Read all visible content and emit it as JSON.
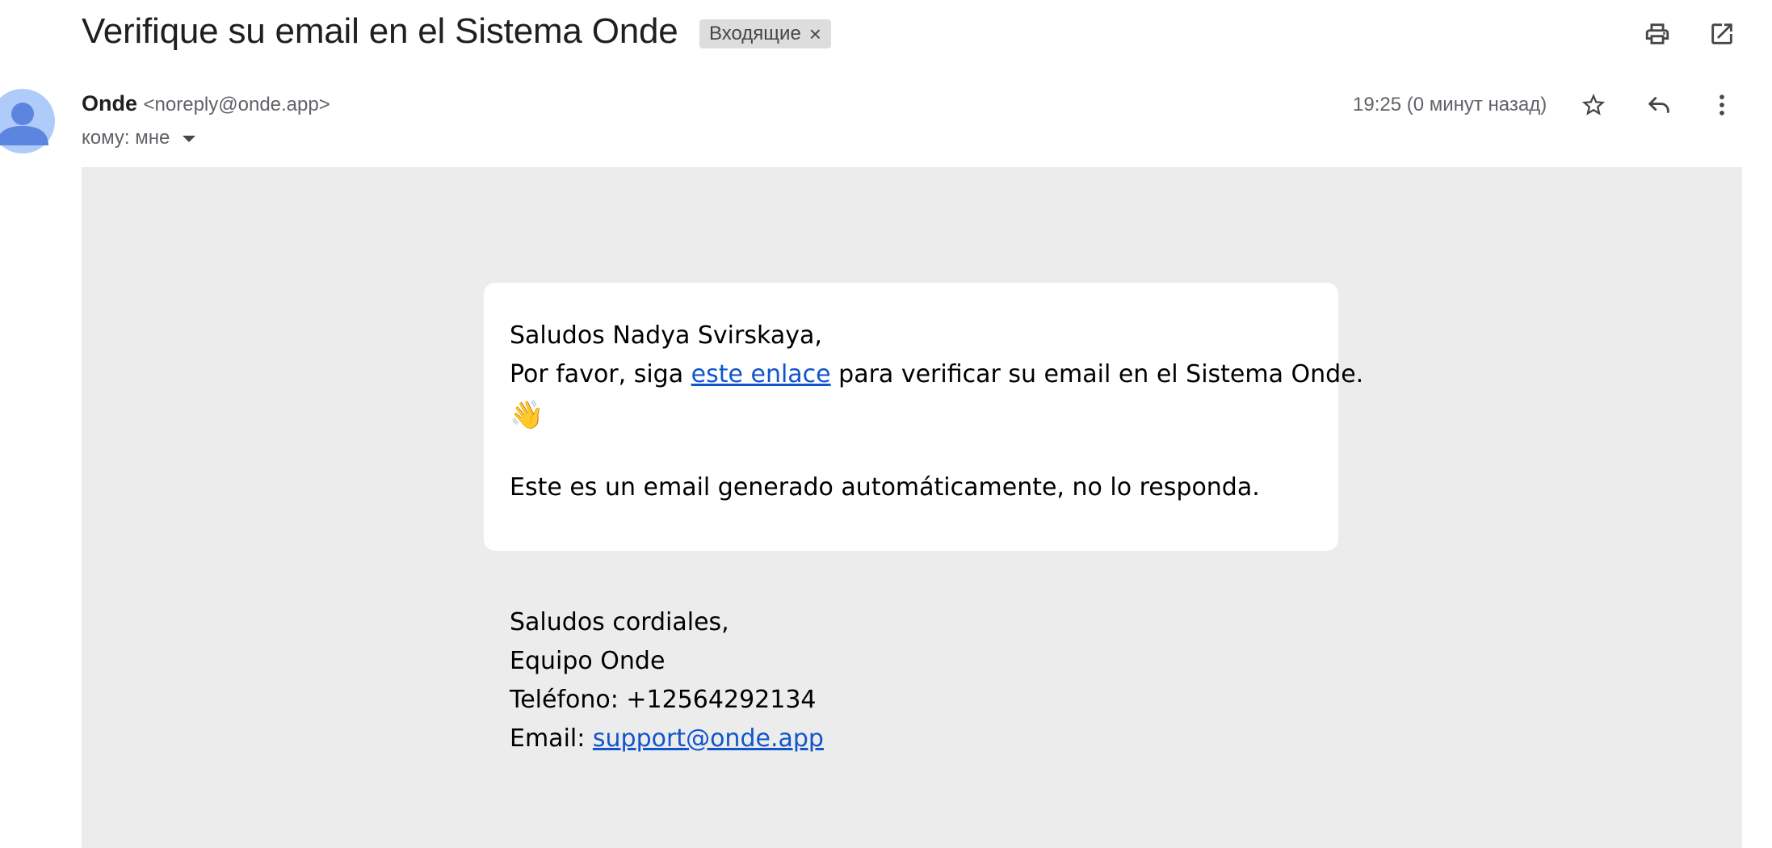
{
  "header": {
    "subject": "Verifique su email en el Sistema Onde",
    "label": "Входящие",
    "label_remove": "×"
  },
  "icons": {
    "print": "print-icon",
    "open_new_window": "open-in-new-window-icon",
    "star": "star-icon",
    "reply": "reply-icon",
    "more": "more-vertical-icon",
    "avatar": "person-avatar-icon"
  },
  "sender": {
    "name": "Onde",
    "email": "<noreply@onde.app>",
    "recipient": "кому: мне",
    "timestamp": "19:25 (0 минут назад)"
  },
  "message": {
    "greeting": "Saludos Nadya Svirskaya,",
    "line_before_link": "Por favor, siga ",
    "link_text": "este enlace",
    "line_after_link": " para verificar su email en el Sistema Onde.",
    "emoji": "👋",
    "auto_notice": "Este es un email generado automáticamente, no lo responda."
  },
  "signature": {
    "closing": "Saludos cordiales,",
    "team": "Equipo Onde",
    "phone": "Teléfono: +12564292134",
    "email_label": "Email: ",
    "email_link": "support@onde.app"
  },
  "colors": {
    "body_background": "#ececec",
    "card_background": "#ffffff",
    "link": "#1155cc",
    "chip_background": "#dddddd",
    "avatar": "#aecbfa",
    "avatar_figure": "#5b85de"
  }
}
